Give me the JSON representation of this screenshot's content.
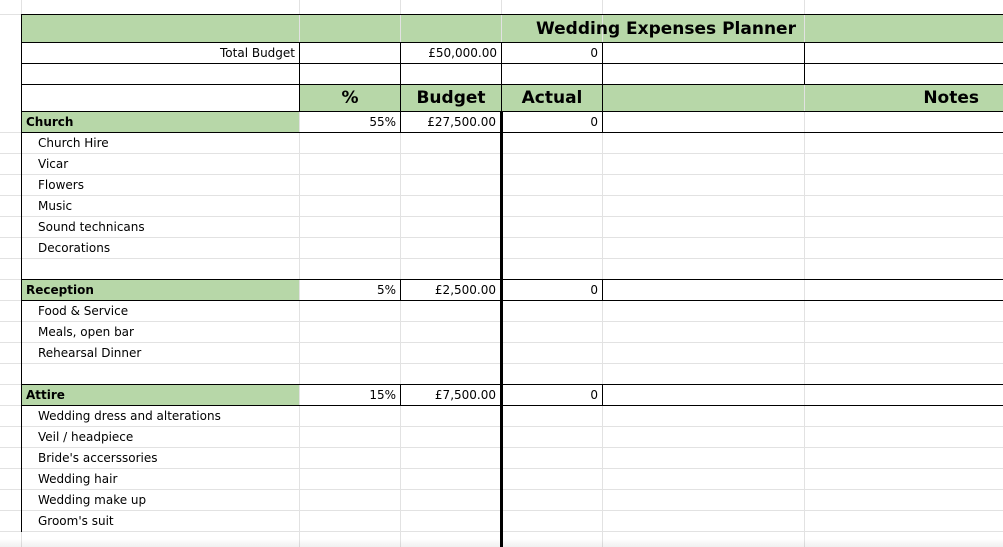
{
  "sheet": {
    "title": "Wedding Expenses Planner",
    "total_budget_label": "Total Budget",
    "total_budget_value": "£50,000.00",
    "total_actual_value": "0",
    "headers": {
      "percent": "%",
      "budget": "Budget",
      "actual": "Actual",
      "notes": "Notes"
    },
    "sections": [
      {
        "name": "Church",
        "percent": "55%",
        "budget": "£27,500.00",
        "actual": "0",
        "items": [
          "Church Hire",
          "Vicar",
          "Flowers",
          "Music",
          "Sound technicans",
          "Decorations"
        ]
      },
      {
        "name": "Reception",
        "percent": "5%",
        "budget": "£2,500.00",
        "actual": "0",
        "items": [
          "Food & Service",
          "Meals, open bar",
          "Rehearsal Dinner"
        ]
      },
      {
        "name": "Attire",
        "percent": "15%",
        "budget": "£7,500.00",
        "actual": "0",
        "items": [
          "Wedding dress and alterations",
          "Veil / headpiece",
          "Bride's accerssories",
          "Wedding hair",
          "Wedding make up",
          "Groom's suit"
        ]
      }
    ]
  },
  "colors": {
    "section_fill": "#b7d7a8",
    "gridline": "#e2e2e2",
    "border": "#000000"
  }
}
